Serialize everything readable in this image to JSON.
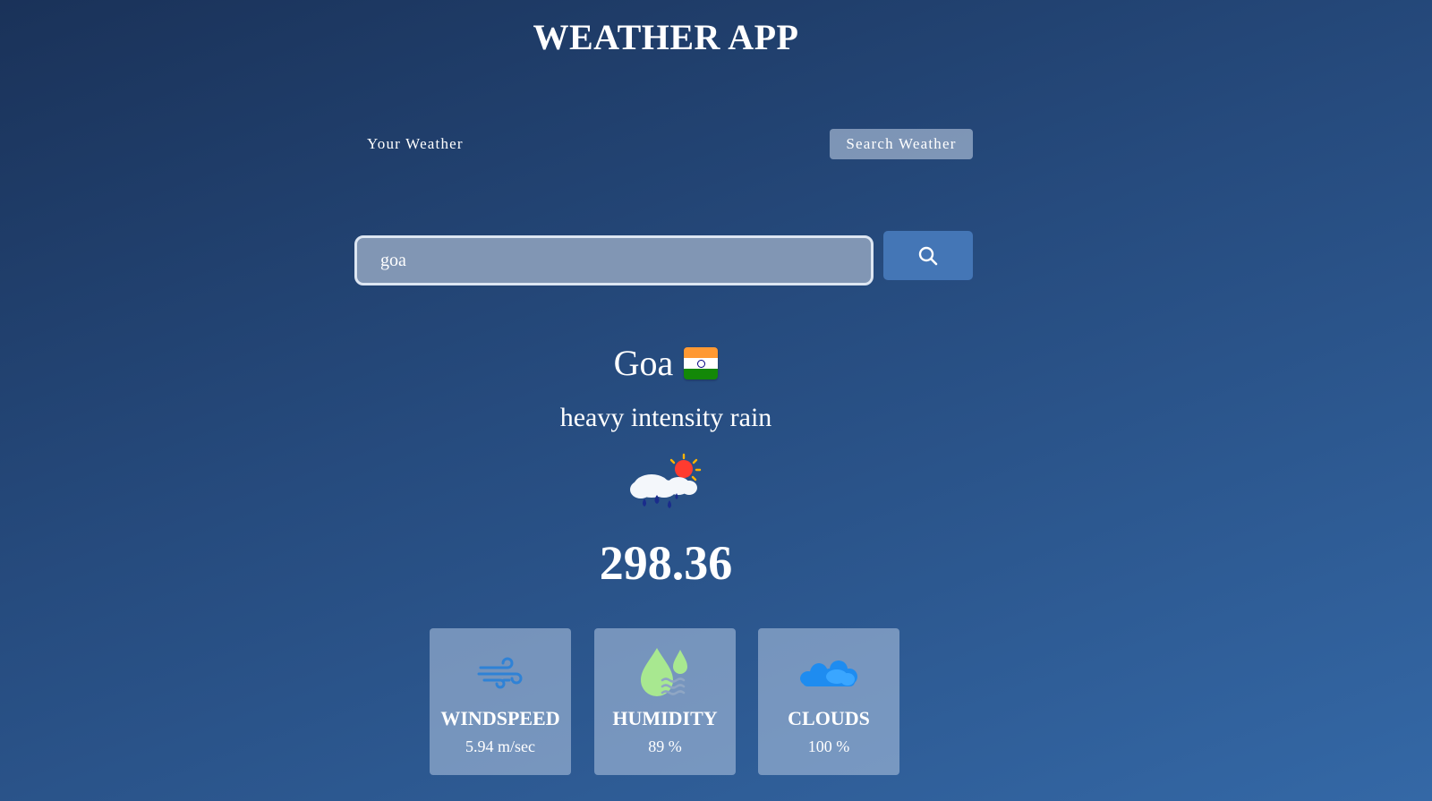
{
  "app": {
    "title": "WEATHER APP"
  },
  "tabs": {
    "your_weather": "Your Weather",
    "search_weather": "Search Weather"
  },
  "search": {
    "value": "goa",
    "button_icon": "search-icon"
  },
  "weather": {
    "city": "Goa",
    "country_flag": "india-flag-icon",
    "description": "heavy intensity rain",
    "condition_icon": "rain-cloud-sun-icon",
    "temperature": "298.36"
  },
  "stats": {
    "windspeed": {
      "label": "WINDSPEED",
      "value": "5.94 m/sec",
      "icon": "wind-icon"
    },
    "humidity": {
      "label": "HUMIDITY",
      "value": "89 %",
      "icon": "humidity-icon"
    },
    "clouds": {
      "label": "CLOUDS",
      "value": "100 %",
      "icon": "clouds-icon"
    }
  },
  "colors": {
    "background_top": "#1a3259",
    "background_bottom": "#3468a6",
    "search_button": "#4476b6",
    "wind_icon": "#2f82d6",
    "humidity_icon": "#a8e890",
    "clouds_icon": "#1e8cf0"
  }
}
